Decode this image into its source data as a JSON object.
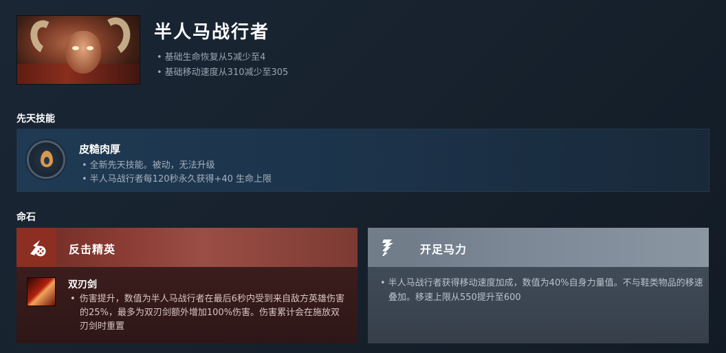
{
  "hero": {
    "name": "半人马战行者",
    "notes": [
      "基础生命恢复从5减少至4",
      "基础移动速度从310减少至305"
    ]
  },
  "innate_section": {
    "label": "先天技能",
    "ability": {
      "name": "皮糙肉厚",
      "notes": [
        "全新先天技能。被动，无法升级",
        "半人马战行者每120秒永久获得+40 生命上限"
      ]
    }
  },
  "facets_section": {
    "label": "命石",
    "left": {
      "icon": "retaliate-icon",
      "name": "反击精英",
      "ability": {
        "icon": "double-edge-icon",
        "name": "双刃剑",
        "notes": [
          "伤害提升，数值为半人马战行者在最后6秒内受到来自敌方英雄伤害的25%，最多为双刃剑额外增加100%伤害。伤害累计会在施放双刃剑时重置"
        ]
      }
    },
    "right": {
      "icon": "hoof-icon",
      "name": "开足马力",
      "notes": [
        "半人马战行者获得移动速度加成，数值为40%自身力量值。不与鞋类物品的移速叠加。移速上限从550提升至600"
      ]
    }
  },
  "colors": {
    "background": "#17222e",
    "innate_panel": "#1f3a53",
    "facet_left": "#8a3b33",
    "facet_right": "#7b8794"
  }
}
